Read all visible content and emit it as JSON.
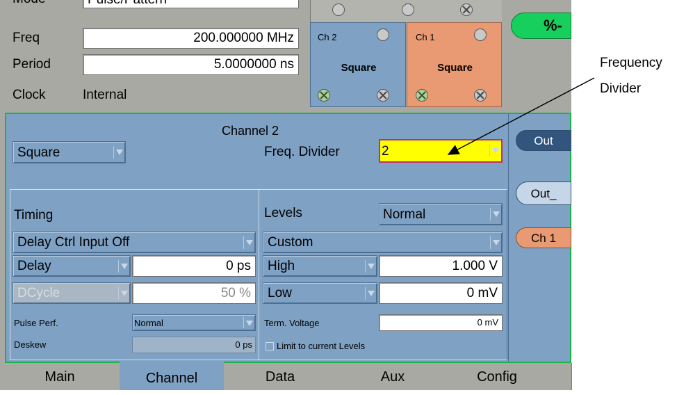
{
  "top": {
    "mode_label": "Mode",
    "mode_value": "Pulse/Pattern",
    "freq_label": "Freq",
    "freq_value": "200.000000 MHz",
    "period_label": "Period",
    "period_value": "5.0000000 ns",
    "clock_label": "Clock",
    "clock_value": "Internal"
  },
  "channels": {
    "ch2_label": "Ch 2",
    "ch2_mode": "Square",
    "ch1_label": "Ch 1",
    "ch1_mode": "Square"
  },
  "annotation": {
    "line1": "Frequency",
    "line2": "Divider"
  },
  "main": {
    "title": "Channel 2",
    "wave_select": "Square",
    "freq_divider_label": "Freq. Divider",
    "freq_divider_value": "2"
  },
  "timing": {
    "heading": "Timing",
    "delay_ctrl": "Delay Ctrl Input Off",
    "delay_label": "Delay",
    "delay_value": "0 ps",
    "dcycle_label": "DCycle",
    "dcycle_value": "50 %",
    "pulse_perf_label": "Pulse Perf.",
    "pulse_perf_value": "Normal",
    "deskew_label": "Deskew",
    "deskew_value": "0 ps"
  },
  "levels": {
    "heading": "Levels",
    "mode_value": "Normal",
    "preset_value": "Custom",
    "high_label": "High",
    "high_value": "1.000 V",
    "low_label": "Low",
    "low_value": "0 mV",
    "term_label": "Term. Voltage",
    "term_value": "0 mV",
    "limit_label": "Limit to current Levels"
  },
  "side": {
    "out": "Out",
    "out_bar": "Out_",
    "ch1": "Ch 1"
  },
  "tabs": [
    "Main",
    "Channel",
    "Data",
    "Aux",
    "Config"
  ],
  "colors": {
    "panel_blue": "#7fa1c4",
    "ch1_orange": "#e99a72",
    "highlight_yellow": "#ffff00",
    "run_green": "#16cf5c",
    "border_green": "#19b34a"
  }
}
